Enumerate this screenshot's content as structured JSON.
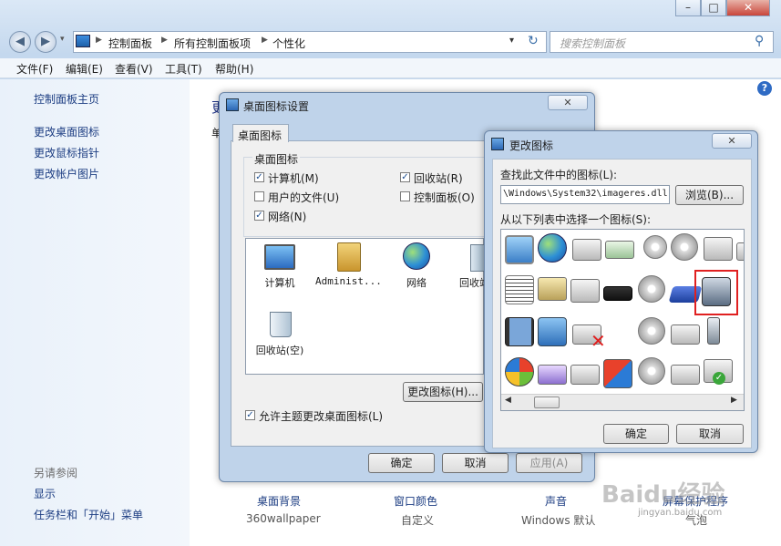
{
  "address": {
    "segments": [
      "控制面板",
      "所有控制面板项",
      "个性化"
    ],
    "search_placeholder": "搜索控制面板"
  },
  "menubar": [
    "文件(F)",
    "编辑(E)",
    "查看(V)",
    "工具(T)",
    "帮助(H)"
  ],
  "left_pane": {
    "links": [
      "控制面板主页",
      "更改桌面图标",
      "更改鼠标指针",
      "更改帐户图片"
    ],
    "see_also_title": "另请参阅",
    "see_also": [
      "显示",
      "任务栏和「开始」菜单"
    ]
  },
  "content": {
    "header_fragment": "更",
    "header_fragment2": "单",
    "bottom_items": [
      {
        "title": "桌面背景",
        "sub": "360wallpaper"
      },
      {
        "title": "窗口颜色",
        "sub": "自定义"
      },
      {
        "title": "声音",
        "sub": "Windows 默认"
      },
      {
        "title": "屏幕保护程序",
        "sub": "气泡"
      }
    ]
  },
  "desktop_icons_dialog": {
    "title": "桌面图标设置",
    "tab": "桌面图标",
    "group": "桌面图标",
    "checkboxes": [
      {
        "label": "计算机(M)",
        "checked": true
      },
      {
        "label": "回收站(R)",
        "checked": true
      },
      {
        "label": "用户的文件(U)",
        "checked": false
      },
      {
        "label": "控制面板(O)",
        "checked": false
      },
      {
        "label": "网络(N)",
        "checked": true
      }
    ],
    "icons": [
      "计算机",
      "Administ...",
      "网络",
      "回收站",
      "回收站(空)"
    ],
    "change_icon_button": "更改图标(H)...",
    "allow_theme": "允许主题更改桌面图标(L)",
    "ok": "确定",
    "cancel": "取消",
    "apply": "应用(A)"
  },
  "change_icon_dialog": {
    "title": "更改图标",
    "find_label": "查找此文件中的图标(L):",
    "path_value": "\\Windows\\System32\\imageres.dll",
    "browse": "浏览(B)...",
    "select_label": "从以下列表中选择一个图标(S):",
    "ok": "确定",
    "cancel": "取消"
  },
  "watermark": "Baidu经验",
  "watermark_url": "jingyan.baidu.com"
}
